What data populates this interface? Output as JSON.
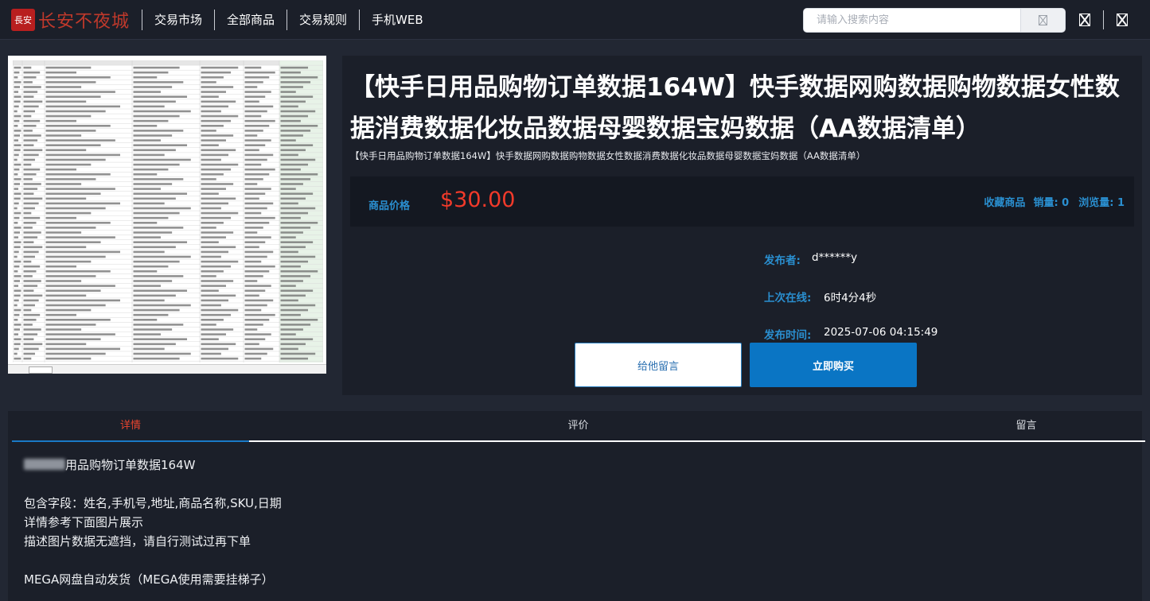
{
  "brand": {
    "seal_text": "長安",
    "name": "长安不夜城"
  },
  "nav": {
    "items": [
      "交易市场",
      "全部商品",
      "交易规则",
      "手机WEB"
    ]
  },
  "search": {
    "placeholder": "请输入搜索内容"
  },
  "icons": {
    "search": "search-icon",
    "user": "user-icon",
    "cart": "cart-icon"
  },
  "colors": {
    "accent": "#2a8fd0",
    "price": "#f23a2a",
    "buy_button": "#0a75c4",
    "tab_active": "#e8452f"
  },
  "product": {
    "title": "【快手日用品购物订单数据164W】快手数据网购数据购物数据女性数据消费数据化妆品数据母婴数据宝妈数据（AA数据清单）",
    "subtitle": "【快手日用品购物订单数据164W】快手数据网购数据购物数据女性数据消费数据化妆品数据母婴数据宝妈数据（AA数据清单）",
    "price_label": "商品价格",
    "price": "$30.00",
    "favorite": "收藏商品",
    "sales": "销量: 0",
    "views": "浏览量: 1",
    "seller_label": "发布者:",
    "seller": "d******y",
    "last_online_label": "上次在线:",
    "last_online": "6时4分4秒",
    "publish_label": "发布时间:",
    "publish_time": "2025-07-06 04:15:49",
    "message_button": "给他留言",
    "buy_button": "立即购买"
  },
  "tabs": [
    "详情",
    "评价",
    "留言"
  ],
  "description": {
    "line1": "用品购物订单数据164W",
    "line2": "",
    "line3": "包含字段：姓名,手机号,地址,商品名称,SKU,日期",
    "line4": "详情参考下面图片展示",
    "line5": "描述图片数据无遮挡，请自行测试过再下单",
    "line6": "",
    "line7": "MEGA网盘自动发货（MEGA使用需要挂梯子）"
  }
}
